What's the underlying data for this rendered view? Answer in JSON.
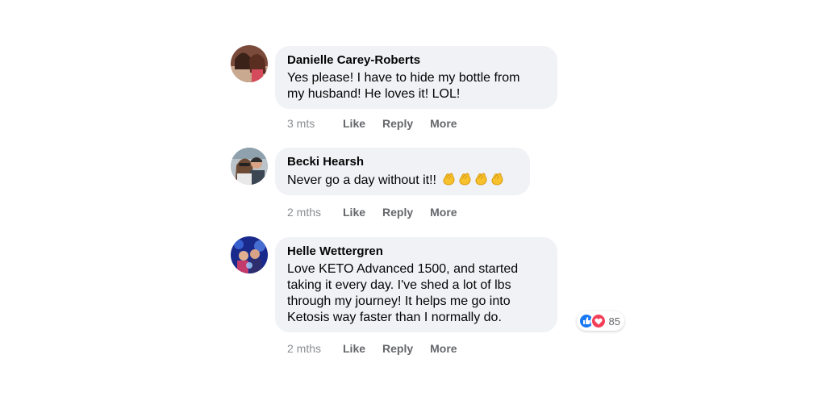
{
  "comments": [
    {
      "author": "Danielle Carey-Roberts",
      "lines": [
        "Yes please! I have to hide my bottle from",
        "my husband! He loves it! LOL!"
      ],
      "time": "3 mts",
      "actions": {
        "like": "Like",
        "reply": "Reply",
        "more": "More"
      },
      "avatar_icon": "profile-photo-icon"
    },
    {
      "author": "Becki Hearsh",
      "lines": [
        "Never go a day without it!!"
      ],
      "emoji": [
        "clapping-hands-icon",
        "clapping-hands-icon",
        "clapping-hands-icon",
        "clapping-hands-icon"
      ],
      "time": "2 mths",
      "actions": {
        "like": "Like",
        "reply": "Reply",
        "more": "More"
      },
      "avatar_icon": "profile-photo-icon"
    },
    {
      "author": "Helle Wettergren",
      "lines": [
        "Love KETO Advanced 1500, and started",
        "taking it every day. I've shed a lot of lbs",
        "through my journey! It helps me go into",
        "Ketosis way faster than I normally do."
      ],
      "time": "2 mths",
      "actions": {
        "like": "Like",
        "reply": "Reply",
        "more": "More"
      },
      "avatar_icon": "profile-photo-icon",
      "reactions": {
        "icons": [
          "like-reaction-icon",
          "love-reaction-icon"
        ],
        "count": "85"
      }
    }
  ],
  "colors": {
    "bubble": "#f0f2f5",
    "text": "#050505",
    "meta": "#8a8d91",
    "action": "#65676b",
    "like_blue": "#1877f2",
    "love_red": "#f33e58"
  }
}
